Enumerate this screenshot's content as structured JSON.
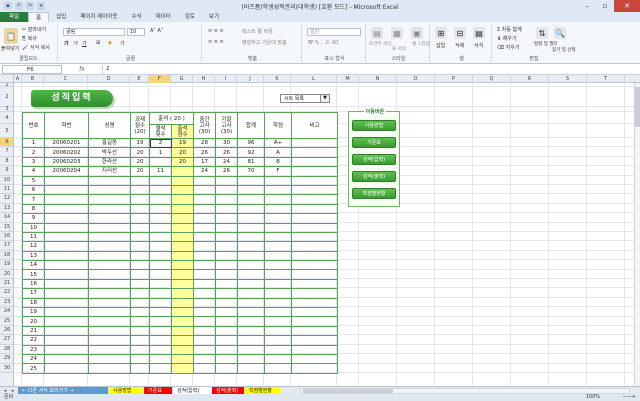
{
  "window": {
    "title": "(비즈폼)학생성적관리(대학생)  [호환 모드]  -  Microsoft Excel"
  },
  "qat": [
    "save-icon",
    "undo-icon",
    "redo-icon",
    "customize-icon"
  ],
  "ribbon_tabs": [
    {
      "label": "파일",
      "kind": "file"
    },
    {
      "label": "홈",
      "kind": "active"
    },
    {
      "label": "삽입",
      "kind": ""
    },
    {
      "label": "페이지 레이아웃",
      "kind": ""
    },
    {
      "label": "수식",
      "kind": ""
    },
    {
      "label": "데이터",
      "kind": ""
    },
    {
      "label": "검토",
      "kind": ""
    },
    {
      "label": "보기",
      "kind": ""
    }
  ],
  "ribbon": {
    "clipboard": {
      "paste": "붙여넣기",
      "cut": "잘라내기",
      "copy": "복사",
      "format_painter": "서식 복사",
      "label": "클립보드"
    },
    "font": {
      "name": "굴림",
      "size": "10",
      "label": "글꼴"
    },
    "alignment": {
      "wrap": "텍스트 줄 바꿈",
      "merge": "병합하고 가운데 맞춤",
      "label": "맞춤"
    },
    "number": {
      "format": "일반",
      "label": "표시 형식"
    },
    "styles": {
      "conditional": "조건부 서식",
      "table": "표 서식",
      "cell": "셀 스타일",
      "label": "스타일"
    },
    "cells": {
      "insert": "삽입",
      "delete": "삭제",
      "format": "서식",
      "label": "셀"
    },
    "editing": {
      "autosum": "자동 합계",
      "fill": "채우기",
      "clear": "지우기",
      "sort": "정렬 및 필터",
      "find": "찾기 및 선택",
      "label": "편집"
    }
  },
  "formula_bar": {
    "cell": "F6",
    "fx": "fx",
    "value": "2"
  },
  "columns": [
    "A",
    "B",
    "C",
    "D",
    "E",
    "F",
    "G",
    "H",
    "I",
    "J",
    "K",
    "L",
    "M",
    "N",
    "O",
    "P",
    "Q",
    "R",
    "S",
    "T"
  ],
  "selected_column": "F",
  "selected_row": "6",
  "sheet": {
    "title": "성적입력",
    "sheet_select": "시트 목록",
    "table": {
      "headers": {
        "no": "번호",
        "id": "학번",
        "name": "성명",
        "assignment": "과제\n점수\n(20)",
        "attendance": "출석 ( 20 )",
        "absent": "결석\n횟수",
        "attend_score": "출석\n점수",
        "midterm": "중간\n고사\n(30)",
        "final": "기말\n고사\n(30)",
        "total": "합계",
        "grade": "학점",
        "note": "비고"
      },
      "rows": [
        {
          "no": "1",
          "id": "20060201",
          "name": "홍길동",
          "assignment": "19",
          "absent": "2",
          "attend": "19",
          "mid": "28",
          "fin": "30",
          "total": "96",
          "grade": "A+"
        },
        {
          "no": "2",
          "id": "20060202",
          "name": "박두산",
          "assignment": "20",
          "absent": "1",
          "attend": "20",
          "mid": "26",
          "fin": "26",
          "total": "92",
          "grade": "A"
        },
        {
          "no": "3",
          "id": "20060203",
          "name": "한라산",
          "assignment": "20",
          "absent": "",
          "attend": "20",
          "mid": "17",
          "fin": "24",
          "total": "81",
          "grade": "B"
        },
        {
          "no": "4",
          "id": "20060204",
          "name": "지리산",
          "assignment": "20",
          "absent": "11",
          "attend": "",
          "mid": "24",
          "fin": "26",
          "total": "70",
          "grade": "F"
        },
        {
          "no": "5"
        },
        {
          "no": "6"
        },
        {
          "no": "7"
        },
        {
          "no": "8"
        },
        {
          "no": "9"
        },
        {
          "no": "10"
        },
        {
          "no": "11"
        },
        {
          "no": "12"
        },
        {
          "no": "13"
        },
        {
          "no": "14"
        },
        {
          "no": "15"
        },
        {
          "no": "16"
        },
        {
          "no": "17"
        },
        {
          "no": "18"
        },
        {
          "no": "19"
        },
        {
          "no": "20"
        },
        {
          "no": "21"
        },
        {
          "no": "22"
        },
        {
          "no": "23"
        },
        {
          "no": "24"
        },
        {
          "no": "25"
        }
      ]
    },
    "nav_panel": {
      "title": "이동버튼",
      "buttons": [
        "사용방법",
        "기준표",
        "성적(입력)",
        "성적(출력)",
        "학점별현황"
      ]
    }
  },
  "sheet_tabs": [
    {
      "label": "← 다른 서식 보러가기 →",
      "color": "#5b9bd5"
    },
    {
      "label": "사용방법",
      "color": "#ffff00"
    },
    {
      "label": "기준표",
      "color": "#ff0000"
    },
    {
      "label": "성적(입력)",
      "color": "#ffffff"
    },
    {
      "label": "성적(출력)",
      "color": "#ff0000"
    },
    {
      "label": "학점별현황",
      "color": "#ffff00"
    }
  ],
  "status": {
    "mode": "준비",
    "zoom": "100%"
  }
}
